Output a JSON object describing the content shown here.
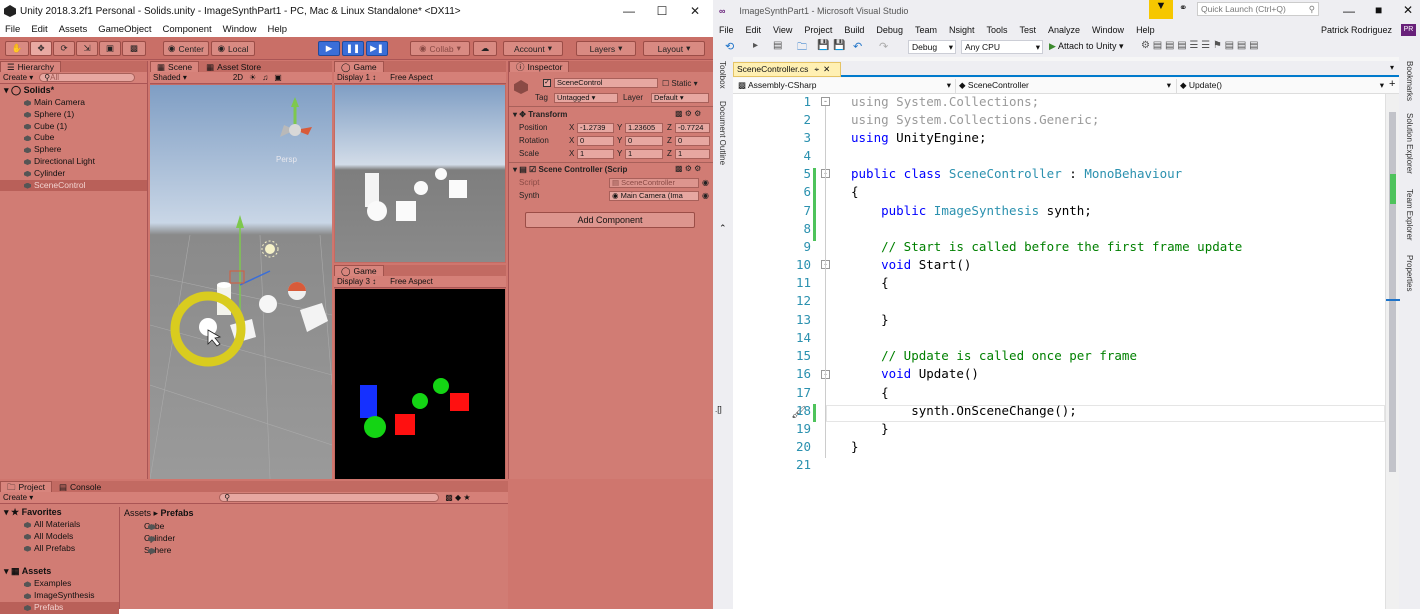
{
  "unity": {
    "title": "Unity 2018.3.2f1 Personal - Solids.unity - ImageSynthPart1 - PC, Mac & Linux Standalone* <DX11>",
    "menu": [
      "File",
      "Edit",
      "Assets",
      "GameObject",
      "Component",
      "Window",
      "Help"
    ],
    "toolbar": {
      "center": "Center",
      "local": "Local",
      "collab": "Collab",
      "account": "Account",
      "layers": "Layers",
      "layout": "Layout"
    },
    "hierarchy": {
      "tab": "Hierarchy",
      "create": "Create",
      "search_placeholder": "All",
      "scene": "Solids*",
      "items": [
        "Main Camera",
        "Sphere (1)",
        "Cube (1)",
        "Cube",
        "Sphere",
        "Directional Light",
        "Cylinder",
        "SceneControl"
      ]
    },
    "scene": {
      "tab": "Scene",
      "tab2": "Asset Store",
      "shading": "Shaded",
      "mode": "2D",
      "persp": "Persp"
    },
    "game1": {
      "tab": "Game",
      "display": "Display 1",
      "aspect": "Free Aspect"
    },
    "game2": {
      "tab": "Game",
      "display": "Display 3",
      "aspect": "Free Aspect"
    },
    "inspector": {
      "tab": "Inspector",
      "name": "SceneControl",
      "static": "Static",
      "tag_label": "Tag",
      "tag": "Untagged",
      "layer_label": "Layer",
      "layer": "Default",
      "transform": "Transform",
      "position": "Position",
      "rotation": "Rotation",
      "scale": "Scale",
      "pos": {
        "x": "-1.2739",
        "y": "1.23605",
        "z": "-0.7724"
      },
      "rot": {
        "x": "0",
        "y": "0",
        "z": "0"
      },
      "scl": {
        "x": "1",
        "y": "1",
        "z": "1"
      },
      "component": "Scene Controller (Scrip",
      "script_label": "Script",
      "script": "SceneController",
      "synth_label": "Synth",
      "synth": "Main Camera (Ima",
      "add_component": "Add Component",
      "axis_x": "X",
      "axis_y": "Y",
      "axis_z": "Z"
    },
    "project": {
      "tab": "Project",
      "tab2": "Console",
      "create": "Create",
      "favorites": "Favorites",
      "fav_items": [
        "All Materials",
        "All Models",
        "All Prefabs"
      ],
      "assets": "Assets",
      "asset_items": [
        "Examples",
        "ImageSynthesis",
        "Prefabs"
      ],
      "breadcrumb_root": "Assets",
      "breadcrumb_leaf": "Prefabs",
      "prefabs": [
        "Cube",
        "Cylinder",
        "Sphere"
      ]
    }
  },
  "vs": {
    "title": "ImageSynthPart1 - Microsoft Visual Studio",
    "quick_launch": "Quick Launch (Ctrl+Q)",
    "user": "Patrick Rodriguez",
    "initials": "PR",
    "menu": [
      "File",
      "Edit",
      "View",
      "Project",
      "Build",
      "Debug",
      "Team",
      "Nsight",
      "Tools",
      "Test",
      "Analyze",
      "Window",
      "Help"
    ],
    "config": "Debug",
    "platform": "Any CPU",
    "attach": "Attach to Unity",
    "left_tools": [
      "Toolbox",
      "Document Outline"
    ],
    "right_tools": [
      "Bookmarks",
      "Solution Explorer",
      "Team Explorer",
      "Properties"
    ],
    "file_tab": "SceneController.cs",
    "nav": {
      "project": "Assembly-CSharp",
      "class": "SceneController",
      "member": "Update()"
    },
    "line_numbers": [
      "1",
      "2",
      "3",
      "4",
      "5",
      "6",
      "7",
      "8",
      "9",
      "10",
      "11",
      "12",
      "13",
      "14",
      "15",
      "16",
      "17",
      "18",
      "19",
      "20",
      "21"
    ],
    "code": {
      "l1a": "using",
      "l1b": " System.Collections;",
      "l2a": "using",
      "l2b": " System.Collections.Generic;",
      "l3a": "using",
      "l3b": " UnityEngine;",
      "l5a": "public class ",
      "l5b": "SceneController",
      "l5c": " : ",
      "l5d": "MonoBehaviour",
      "l6": "{",
      "l7a": "    public ",
      "l7b": "ImageSynthesis",
      "l7c": " synth;",
      "l9": "    // Start is called before the first frame update",
      "l10a": "    void ",
      "l10b": "Start()",
      "l11": "    {",
      "l13": "    }",
      "l15": "    // Update is called once per frame",
      "l16a": "    void ",
      "l16b": "Update()",
      "l17": "    {",
      "l18": "        synth.OnSceneChange();",
      "l19": "    }",
      "l20": "}"
    }
  },
  "colors": {
    "unity_bg": "#cf766e",
    "vs_blue": "#007acc",
    "game_black": "#000000"
  }
}
